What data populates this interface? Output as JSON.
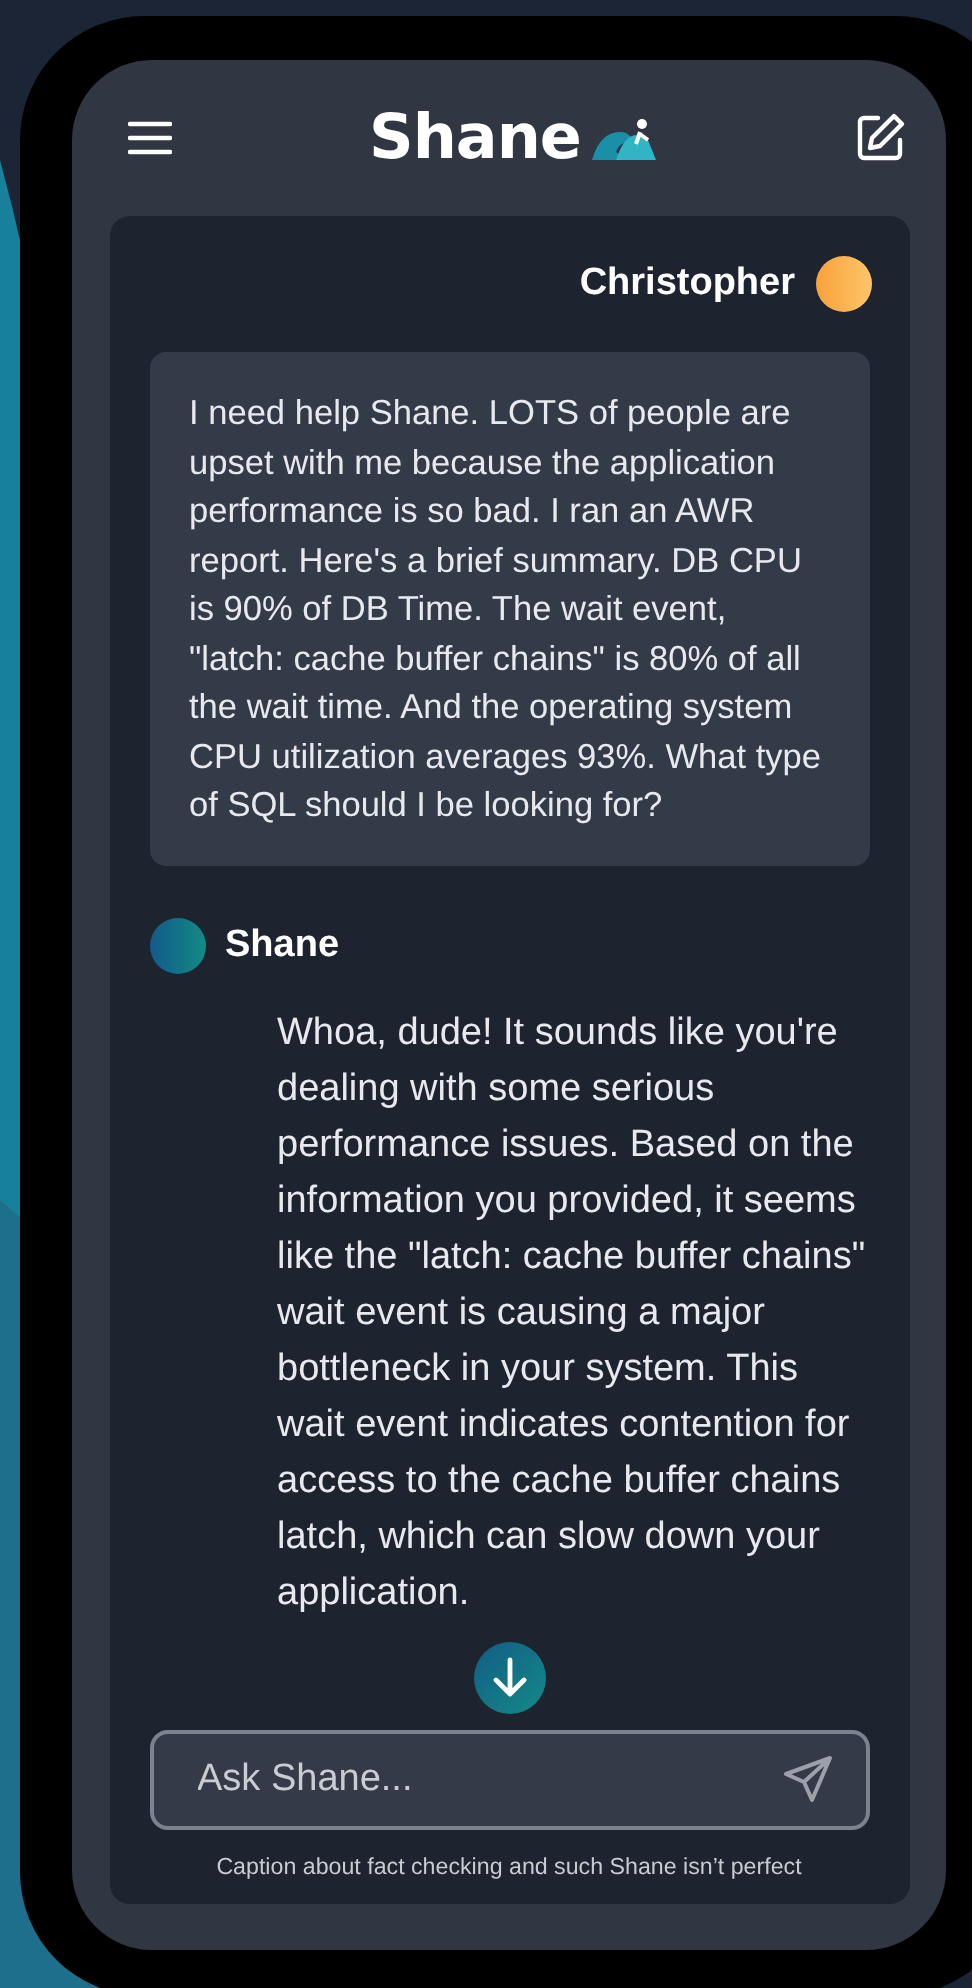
{
  "header": {
    "title": "Shane"
  },
  "messages": [
    {
      "kind": "user",
      "author": "Christopher",
      "text": "I need help Shane. LOTS of people are upset with me because the application performance is so bad. I ran an AWR report. Here's a brief summary. DB CPU is 90% of DB Time. The wait event, \"latch: cache buffer chains\" is 80% of all the wait time. And the operating system CPU utilization averages 93%. What type of SQL should I be looking for?"
    },
    {
      "kind": "assistant",
      "author": "Shane",
      "text": "Whoa, dude! It sounds like you're dealing with some serious performance issues. Based on the information you provided, it seems like the \"latch: cache buffer chains\" wait event is causing a major bottleneck in your system. This wait event indicates contention for access to the cache buffer chains latch, which can slow down your application."
    }
  ],
  "composer": {
    "placeholder": "Ask Shane..."
  },
  "caption": "Caption about fact checking and such Shane isn’t perfect"
}
